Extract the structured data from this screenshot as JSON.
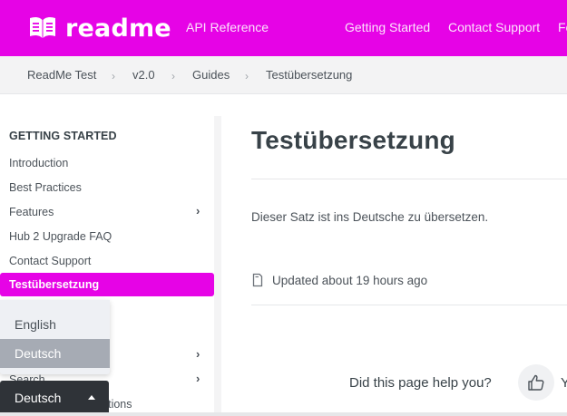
{
  "header": {
    "logo_text": "readme",
    "nav": [
      "API Reference",
      "Getting Started",
      "Contact Support",
      "Fe"
    ]
  },
  "breadcrumb": [
    "ReadMe Test",
    "v2.0",
    "Guides",
    "Testübersetzung"
  ],
  "sidebar": {
    "heading": "GETTING STARTED",
    "items": [
      {
        "label": "Introduction"
      },
      {
        "label": "Best Practices"
      },
      {
        "label": "Features"
      },
      {
        "label": "Hub 2 Upgrade FAQ"
      },
      {
        "label": "Contact Support"
      },
      {
        "label": "Testübersetzung"
      },
      {
        "label": "Search"
      },
      {
        "label": "Enable/Disable Sections"
      }
    ]
  },
  "language": {
    "options": [
      "English",
      "Deutsch"
    ],
    "selected": "Deutsch"
  },
  "main": {
    "title": "Testübersetzung",
    "body": "Dieser Satz ist ins Deutsche zu übersetzen.",
    "updated": "Updated about 19 hours ago",
    "feedback_question": "Did this page help you?",
    "yes_partial": "Y"
  },
  "colors": {
    "brand": "#e603e6",
    "text": "#384248",
    "language_button": "#2f3338"
  },
  "icons": {
    "logo": "readme-book-icon",
    "breadcrumb_separator": "chevron-right-icon",
    "updated": "document-icon",
    "thumbs_up": "thumbs-up-icon",
    "caret": "caret-up-icon"
  }
}
